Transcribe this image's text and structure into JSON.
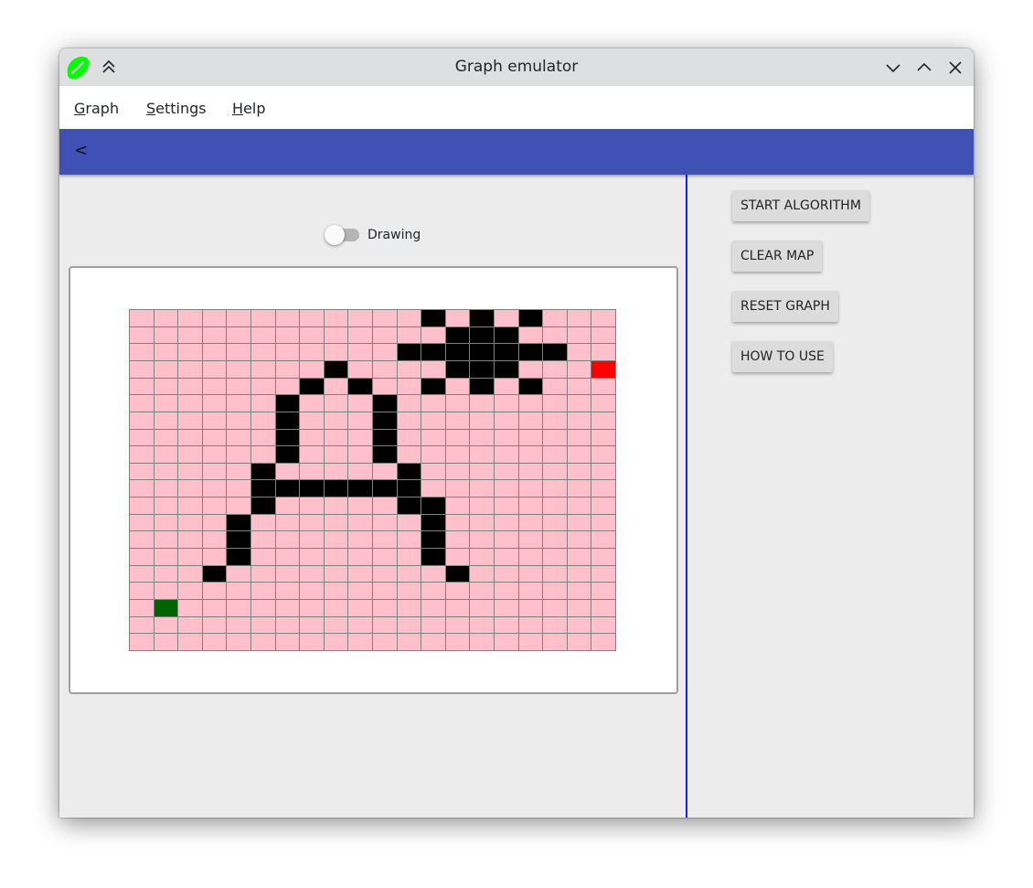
{
  "window": {
    "title": "Graph emulator"
  },
  "menu": {
    "graph": {
      "mnemonic": "G",
      "rest": "raph"
    },
    "settings": {
      "mnemonic": "S",
      "rest": "ettings"
    },
    "help": {
      "mnemonic": "H",
      "rest": "elp"
    }
  },
  "toolbar": {
    "back_label": "<",
    "color": "#3f51b5"
  },
  "drawing_toggle": {
    "label": "Drawing",
    "checked": false
  },
  "buttons": {
    "start_algorithm": "START ALGORITHM",
    "clear_map": "CLEAR MAP",
    "reset_graph": "RESET GRAPH",
    "how_to_use": "HOW TO USE"
  },
  "grid": {
    "rows": 20,
    "cols": 20,
    "colors": {
      "empty": "#ffc0cb",
      "wall": "#000000",
      "start": "#006400",
      "end": "#ff0000",
      "line": "#808080"
    },
    "walls": [
      [
        0,
        12
      ],
      [
        0,
        14
      ],
      [
        0,
        16
      ],
      [
        1,
        13
      ],
      [
        1,
        14
      ],
      [
        1,
        15
      ],
      [
        2,
        11
      ],
      [
        2,
        12
      ],
      [
        2,
        13
      ],
      [
        2,
        14
      ],
      [
        2,
        15
      ],
      [
        2,
        16
      ],
      [
        2,
        17
      ],
      [
        3,
        8
      ],
      [
        3,
        13
      ],
      [
        3,
        14
      ],
      [
        3,
        15
      ],
      [
        4,
        7
      ],
      [
        4,
        9
      ],
      [
        4,
        12
      ],
      [
        4,
        14
      ],
      [
        4,
        16
      ],
      [
        5,
        6
      ],
      [
        5,
        10
      ],
      [
        6,
        6
      ],
      [
        6,
        10
      ],
      [
        7,
        6
      ],
      [
        7,
        10
      ],
      [
        8,
        6
      ],
      [
        8,
        10
      ],
      [
        9,
        5
      ],
      [
        9,
        11
      ],
      [
        10,
        5
      ],
      [
        10,
        6
      ],
      [
        10,
        7
      ],
      [
        10,
        8
      ],
      [
        10,
        9
      ],
      [
        10,
        10
      ],
      [
        10,
        11
      ],
      [
        11,
        5
      ],
      [
        11,
        11
      ],
      [
        11,
        12
      ],
      [
        12,
        4
      ],
      [
        12,
        12
      ],
      [
        13,
        4
      ],
      [
        13,
        12
      ],
      [
        14,
        4
      ],
      [
        14,
        12
      ],
      [
        15,
        3
      ],
      [
        15,
        13
      ]
    ],
    "start": [
      17,
      1
    ],
    "end": [
      3,
      19
    ]
  }
}
